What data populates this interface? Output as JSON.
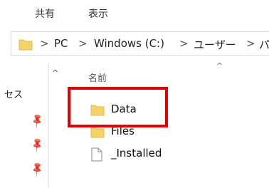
{
  "ribbon": {
    "tabs": [
      "共有",
      "表示"
    ]
  },
  "address": {
    "crumbs": [
      "PC",
      "Windows (C:)",
      "ユーザー",
      "パ"
    ],
    "separator": ">"
  },
  "nav": {
    "quick_access_label": "セス",
    "scroll_up": "^"
  },
  "columns": {
    "name": "名前",
    "sort_indicator": "^"
  },
  "files": [
    {
      "name": "Data",
      "icon": "folder-icon"
    },
    {
      "name": "Files",
      "icon": "folder-icon"
    },
    {
      "name": "_Installed",
      "icon": "file-icon"
    }
  ],
  "colors": {
    "highlight": "#e00000",
    "folder": "#f5d36b"
  }
}
